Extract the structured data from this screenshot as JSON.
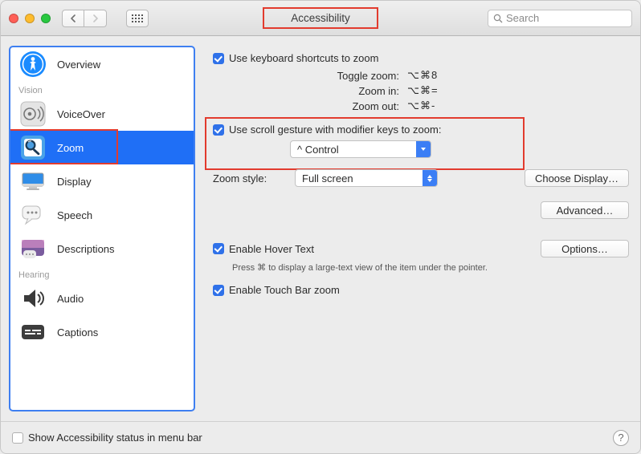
{
  "window": {
    "title": "Accessibility"
  },
  "toolbar": {
    "search_placeholder": "Search"
  },
  "sidebar": {
    "groups": {
      "vision": "Vision",
      "hearing": "Hearing"
    },
    "items": {
      "overview": "Overview",
      "voiceover": "VoiceOver",
      "zoom": "Zoom",
      "display": "Display",
      "speech": "Speech",
      "descriptions": "Descriptions",
      "audio": "Audio",
      "captions": "Captions"
    }
  },
  "main": {
    "use_shortcuts": "Use keyboard shortcuts to zoom",
    "shortcuts": {
      "toggle_label": "Toggle zoom:",
      "toggle_keys": "⌥⌘8",
      "in_label": "Zoom in:",
      "in_keys": "⌥⌘=",
      "out_label": "Zoom out:",
      "out_keys": "⌥⌘-"
    },
    "use_scroll": "Use scroll gesture with modifier keys to zoom:",
    "modifier_value": "^ Control",
    "zoom_style_label": "Zoom style:",
    "zoom_style_value": "Full screen",
    "choose_display": "Choose Display…",
    "advanced": "Advanced…",
    "enable_hover": "Enable Hover Text",
    "options": "Options…",
    "hover_hint": "Press ⌘ to display a large-text view of the item under the pointer.",
    "enable_touchbar": "Enable Touch Bar zoom"
  },
  "footer": {
    "menubar_label": "Show Accessibility status in menu bar",
    "help": "?"
  }
}
